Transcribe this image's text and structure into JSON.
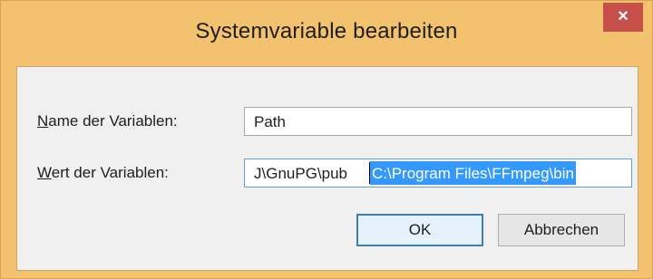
{
  "window": {
    "title": "Systemvariable bearbeiten",
    "close_glyph": "×"
  },
  "form": {
    "name_label_accel": "N",
    "name_label_rest": "ame der Variablen:",
    "name_value": "Path",
    "value_label_accel": "W",
    "value_label_rest": "ert der Variablen:",
    "value_visible_unselected": "J\\GnuPG\\pub",
    "value_visible_selected": "C:\\Program Files\\FFmpeg\\bin"
  },
  "buttons": {
    "ok_label": "OK",
    "cancel_label": "Abbrechen"
  },
  "colors": {
    "titlebar": "#f3c26f",
    "close_button": "#c7504b",
    "selection": "#3399ff",
    "dialog_background": "#f0f0f0"
  },
  "icons": {
    "close": "close-icon"
  }
}
